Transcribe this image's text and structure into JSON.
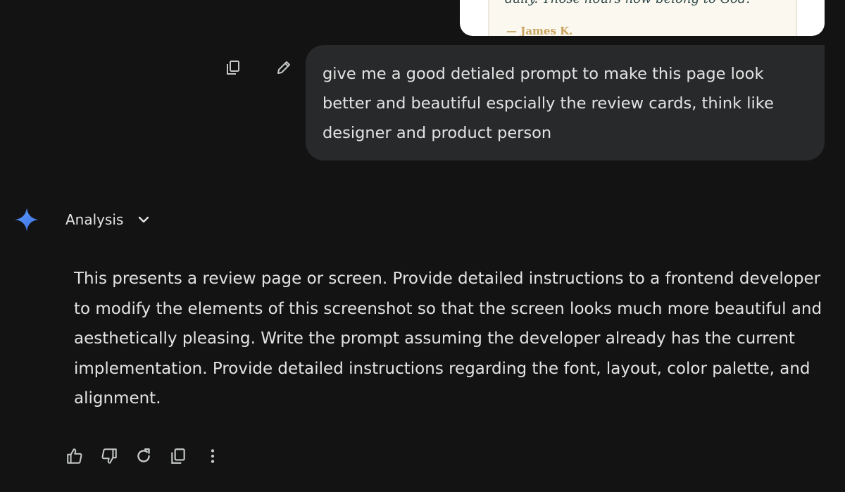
{
  "preview": {
    "quote": "daily. Those hours now belong to God.",
    "author": "— James K."
  },
  "user_message": {
    "text": "give me a good detialed prompt to make this page look better and beautiful espcially the review cards, think like designer and product person",
    "actions": [
      "copy-icon",
      "edit-icon"
    ]
  },
  "assistant": {
    "header_label": "Analysis",
    "response": "This presents a review page or screen. Provide detailed instructions to a frontend developer to modify the elements of this screenshot so that the screen looks much more beautiful and aesthetically pleasing. Write the prompt assuming the developer already has the current implementation. Provide detailed instructions regarding the font, layout, color palette, and alignment.",
    "actions": [
      "thumbs-up-icon",
      "thumbs-down-icon",
      "regenerate-icon",
      "copy-icon",
      "more-icon"
    ]
  },
  "colors": {
    "background": "#131314",
    "bubble": "#28292a",
    "text": "#e3e3e3",
    "accent_spark": "#4a8af4"
  }
}
